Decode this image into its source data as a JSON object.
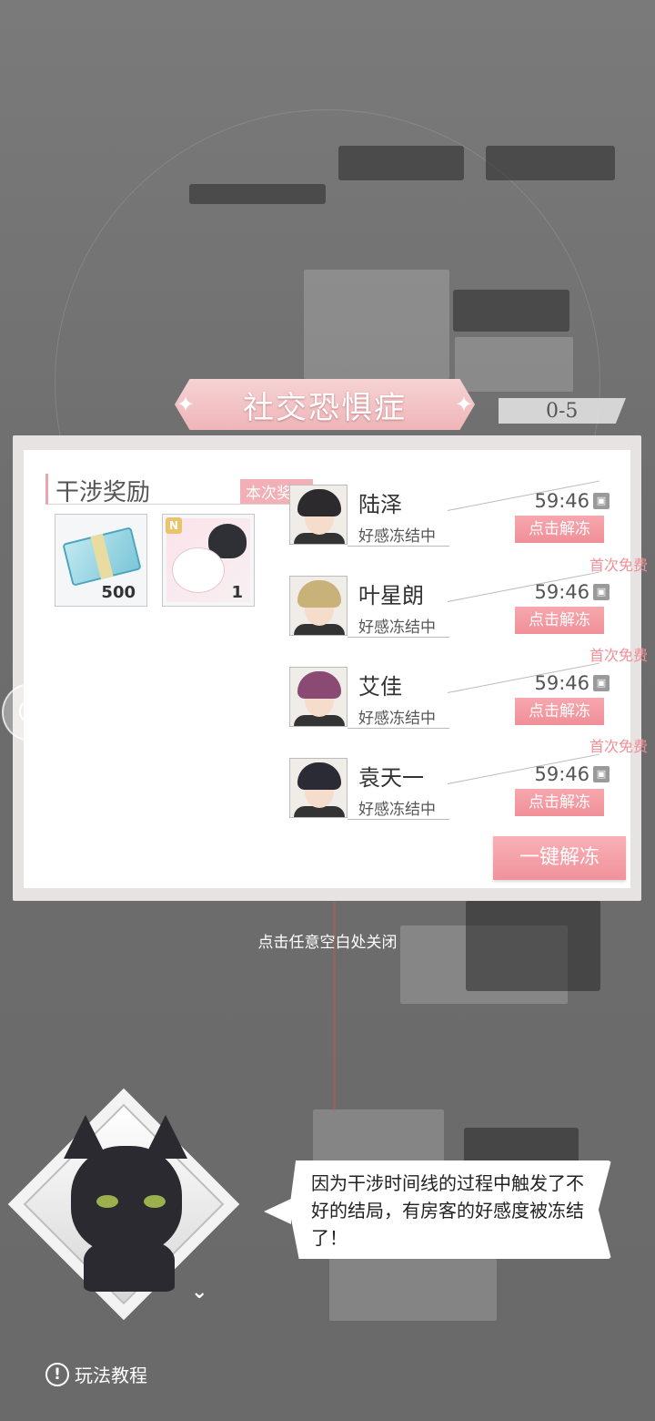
{
  "title": "社交恐惧症",
  "level": "0-5",
  "rewards_section": {
    "title": "干涉奖励",
    "tag": "本次奖励",
    "items": [
      {
        "icon": "cash-bundle-icon",
        "qty": "500"
      },
      {
        "icon": "cat-card-icon",
        "badge": "N",
        "qty": "1"
      }
    ]
  },
  "characters": [
    {
      "name": "陆泽",
      "state": "好感冻结中",
      "timer": "59:46",
      "button": "点击解冻",
      "free": "首次免费",
      "hair": "#2d2a2e"
    },
    {
      "name": "叶星朗",
      "state": "好感冻结中",
      "timer": "59:46",
      "button": "点击解冻",
      "free": "首次免费",
      "hair": "#c9b27a"
    },
    {
      "name": "艾佳",
      "state": "好感冻结中",
      "timer": "59:46",
      "button": "点击解冻",
      "free": "首次免费",
      "hair": "#8a4a74"
    },
    {
      "name": "袁天一",
      "state": "好感冻结中",
      "timer": "59:46",
      "button": "点击解冻",
      "hair": "#2b2b35"
    }
  ],
  "unfreeze_all": "一键解冻",
  "close_hint": "点击任意空白处关闭",
  "dialogue": "因为干涉时间线的过程中触发了不好的结局，有房客的好感度被冻结了！",
  "tutorial": "玩法教程",
  "colors": {
    "accent": "#f08f98",
    "panel": "#ffffff"
  }
}
